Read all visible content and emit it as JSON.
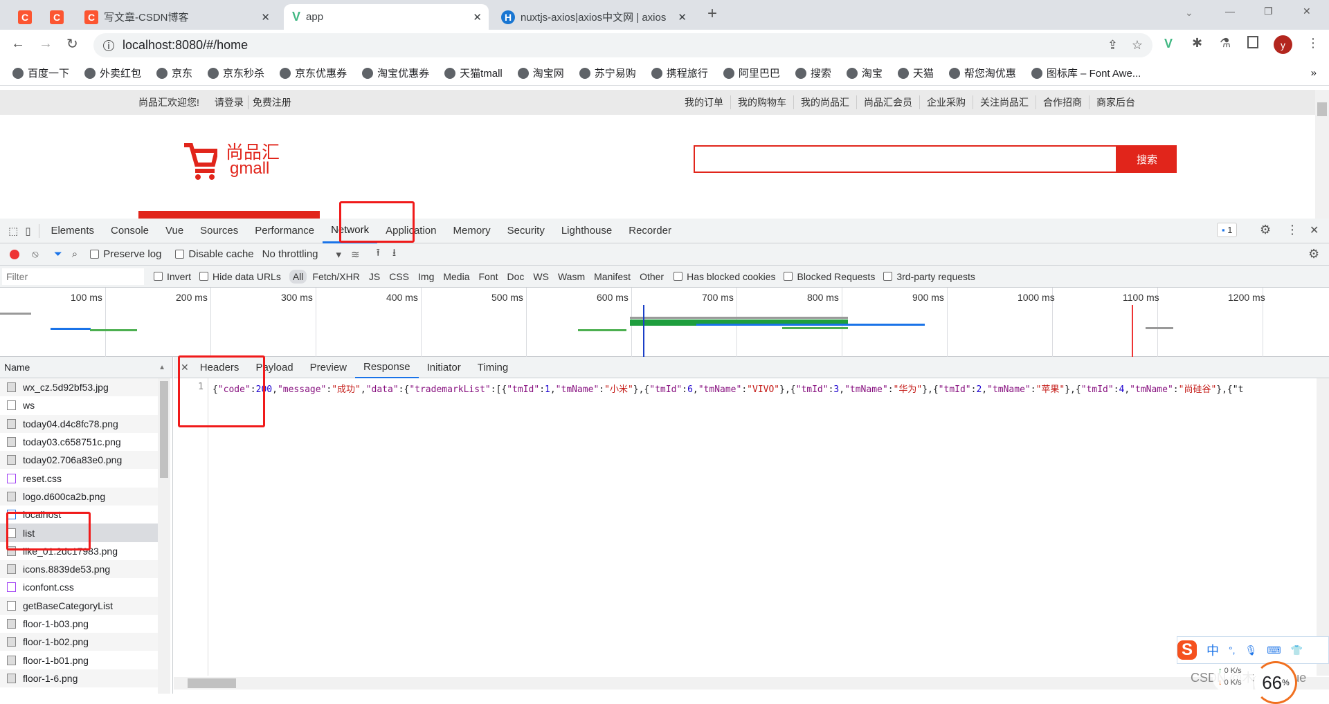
{
  "browser": {
    "tabs": [
      {
        "label": "",
        "icon": "csdn-icon"
      },
      {
        "label": "",
        "icon": "csdn-icon"
      },
      {
        "label": "写文章-CSDN博客",
        "icon": "csdn-icon"
      },
      {
        "label": "app",
        "icon": "vue-icon",
        "active": true
      },
      {
        "label": "nuxtjs-axios|axios中文网 | axios",
        "icon": "h-icon"
      }
    ],
    "url": "localhost:8080/#/home",
    "profile_initial": "y",
    "bookmarks": [
      "百度一下",
      "外卖红包",
      "京东",
      "京东秒杀",
      "京东优惠券",
      "淘宝优惠券",
      "天猫tmall",
      "淘宝网",
      "苏宁易购",
      "携程旅行",
      "阿里巴巴",
      "搜索",
      "淘宝",
      "天猫",
      "帮您淘优惠",
      "图标库 – Font Awe..."
    ],
    "more": "»"
  },
  "site": {
    "welcome": "尚品汇欢迎您!",
    "login": "请登录",
    "register": "免费注册",
    "nav": [
      "我的订单",
      "我的购物车",
      "我的尚品汇",
      "尚品汇会员",
      "企业采购",
      "关注尚品汇",
      "合作招商",
      "商家后台"
    ],
    "logo_cn": "尚品汇",
    "logo_en": "gmall",
    "search_button": "搜索",
    "search_value": "",
    "accent": "#e1251b"
  },
  "devtools": {
    "tabs": [
      "Elements",
      "Console",
      "Vue",
      "Sources",
      "Performance",
      "Network",
      "Application",
      "Memory",
      "Security",
      "Lighthouse",
      "Recorder"
    ],
    "active_tab": "Network",
    "issues_count": "1",
    "preserve_log": "Preserve log",
    "disable_cache": "Disable cache",
    "throttling": "No throttling",
    "filter_placeholder": "Filter",
    "invert": "Invert",
    "hide_data_urls": "Hide data URLs",
    "types": [
      "All",
      "Fetch/XHR",
      "JS",
      "CSS",
      "Img",
      "Media",
      "Font",
      "Doc",
      "WS",
      "Wasm",
      "Manifest",
      "Other"
    ],
    "blocked_cookies": "Has blocked cookies",
    "blocked_requests": "Blocked Requests",
    "third_party": "3rd-party requests",
    "timeline_ticks": [
      "100 ms",
      "200 ms",
      "300 ms",
      "400 ms",
      "500 ms",
      "600 ms",
      "700 ms",
      "800 ms",
      "900 ms",
      "1000 ms",
      "1100 ms",
      "1200 ms"
    ],
    "name_header": "Name",
    "requests": [
      "wx_cz.5d92bf53.jpg",
      "ws",
      "today04.d4c8fc78.png",
      "today03.c658751c.png",
      "today02.706a83e0.png",
      "reset.css",
      "logo.d600ca2b.png",
      "localhost",
      "list",
      "like_01.2dc17983.png",
      "icons.8839de53.png",
      "iconfont.css",
      "getBaseCategoryList",
      "floor-1-b03.png",
      "floor-1-b02.png",
      "floor-1-b01.png",
      "floor-1-6.png"
    ],
    "selected_request": "list",
    "detail_tabs": [
      "Headers",
      "Payload",
      "Preview",
      "Response",
      "Initiator",
      "Timing"
    ],
    "active_detail_tab": "Response",
    "line_number": "1",
    "response": "{\"code\":200,\"message\":\"成功\",\"data\":{\"trademarkList\":[{\"tmId\":1,\"tmName\":\"小米\"},{\"tmId\":6,\"tmName\":\"VIVO\"},{\"tmId\":3,\"tmName\":\"华为\"},{\"tmId\":2,\"tmName\":\"苹果\"},{\"tmId\":4,\"tmName\":\"尚硅谷\"},{\"t"
  },
  "overlay": {
    "ime": "中",
    "watermark": "CSDN @木一hliuyue",
    "speed_up": "0 K/s",
    "speed_down": "0 K/s",
    "percent": "66",
    "percent_sign": "%"
  }
}
